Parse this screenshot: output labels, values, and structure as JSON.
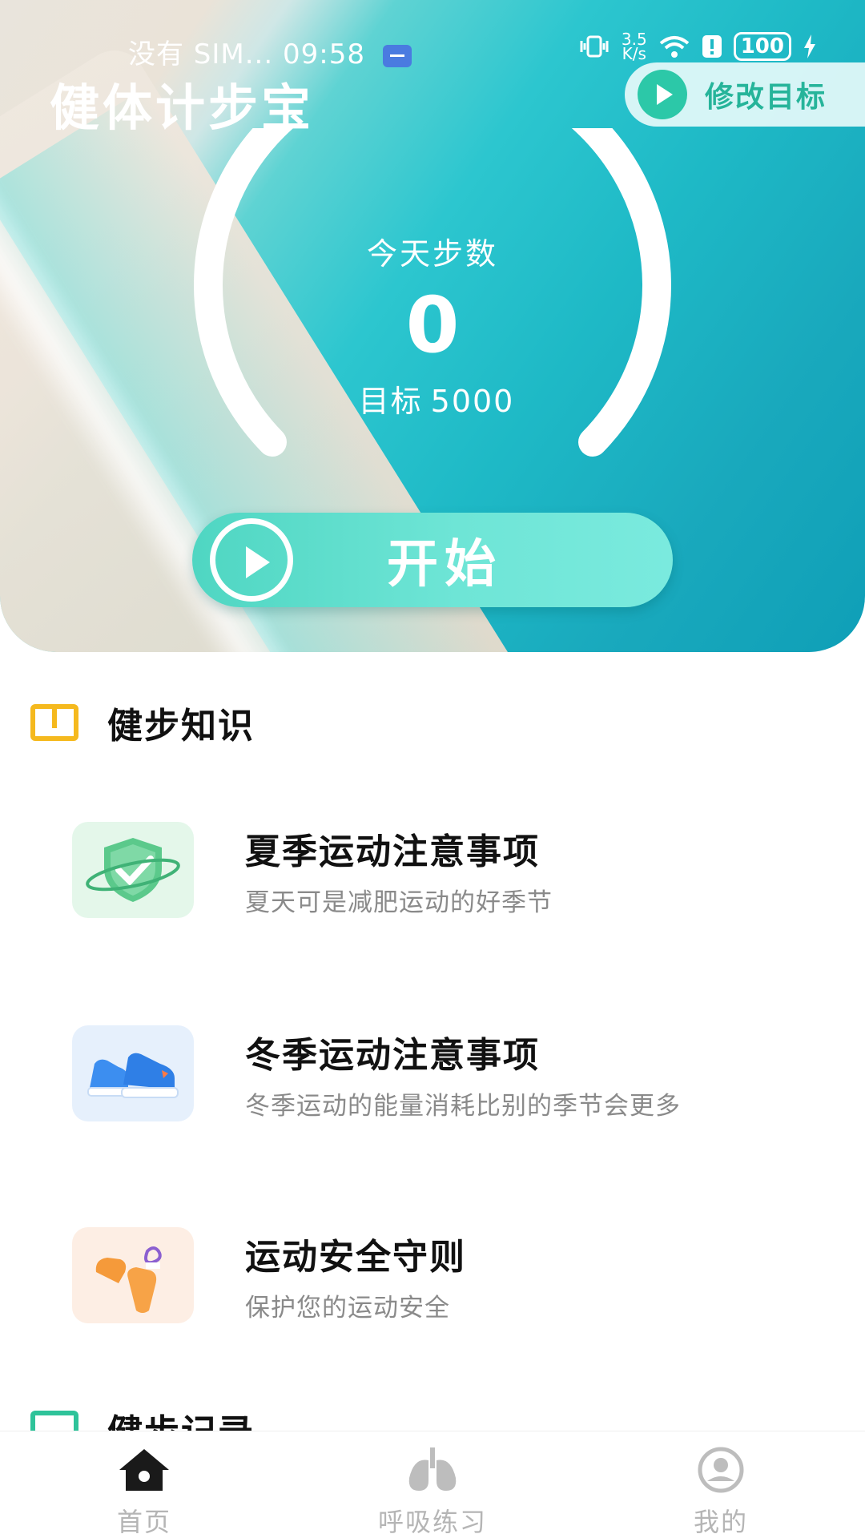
{
  "status_bar": {
    "carrier_time": "没有 SIM... 09:58",
    "net_speed": "3.5\nK/s",
    "battery": "100"
  },
  "app": {
    "title": "健体计步宝"
  },
  "goal_button": {
    "label": "修改目标"
  },
  "pedometer": {
    "label": "今天步数",
    "steps": "0",
    "target_label": "目标",
    "target_value": "5000",
    "progress": 0
  },
  "start_button": {
    "label": "开始"
  },
  "knowledge": {
    "title": "健步知识",
    "items": [
      {
        "title": "夏季运动注意事项",
        "subtitle": "夏天可是减肥运动的好季节",
        "icon": "shield-check-icon"
      },
      {
        "title": "冬季运动注意事项",
        "subtitle": "冬季运动的能量消耗比别的季节会更多",
        "icon": "sneakers-icon"
      },
      {
        "title": "运动安全守则",
        "subtitle": "保护您的运动安全",
        "icon": "mittens-icon"
      }
    ]
  },
  "records": {
    "title": "健步记录"
  },
  "nav": {
    "items": [
      {
        "label": "首页",
        "icon": "home-icon",
        "active": true
      },
      {
        "label": "呼吸练习",
        "icon": "lungs-icon",
        "active": false
      },
      {
        "label": "我的",
        "icon": "profile-icon",
        "active": false
      }
    ]
  },
  "colors": {
    "accent": "#2cc8a8",
    "knowledge_icon": "#f5b91e",
    "record_icon": "#2fc39a",
    "nav_inactive": "#b5b5b5"
  }
}
